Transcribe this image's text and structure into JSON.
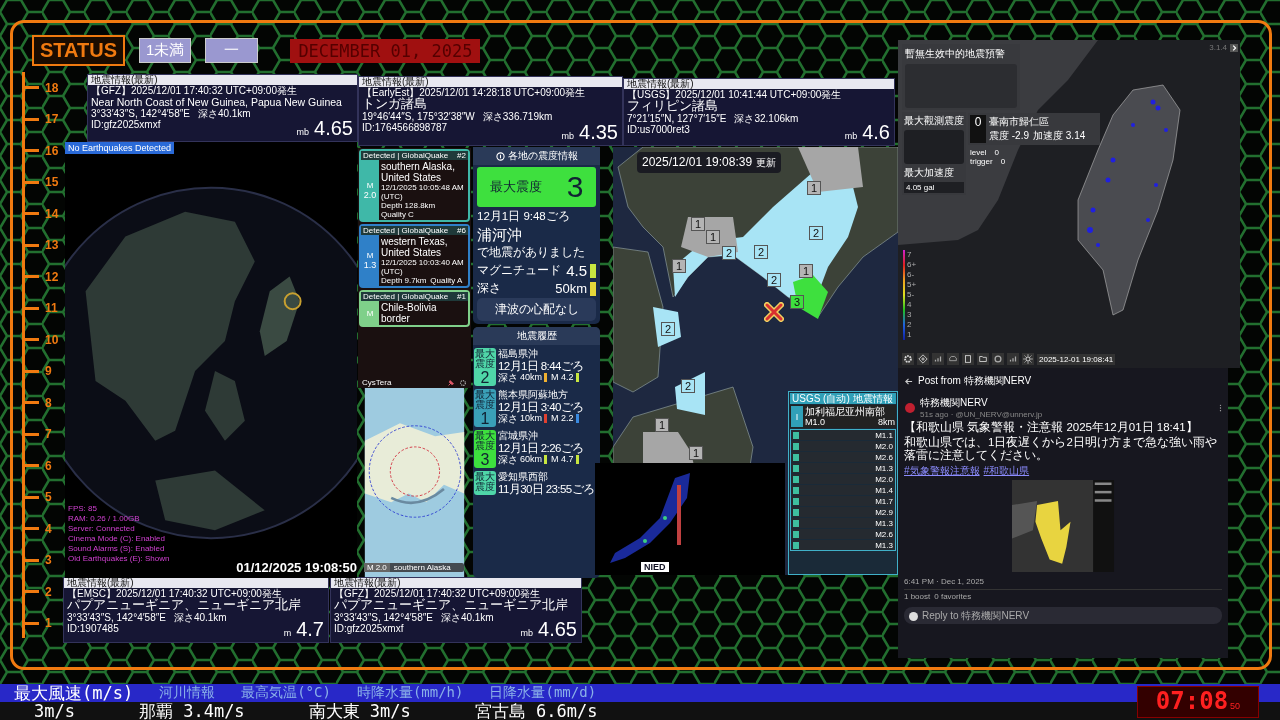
{
  "scale": [
    "18",
    "17",
    "16",
    "15",
    "14",
    "13",
    "12",
    "11",
    "10",
    "9",
    "8",
    "7",
    "6",
    "5",
    "4",
    "3",
    "2",
    "1"
  ],
  "status": {
    "label": "STATUS",
    "level": "1未満",
    "dash": "一",
    "date": "DECEMBER 01, 2025"
  },
  "quake_cards": [
    {
      "header": "地震情報(最新)",
      "source_time": "【GFZ】2025/12/01 17:40:32 UTC+09:00発生",
      "place": "Near North Coast of New Guinea, Papua New Guinea",
      "coords": "3°33′43″S, 142°4′58″E",
      "depth": "深さ40.1km",
      "id": "ID:gfz2025xmxf",
      "mag_type": "mb",
      "magnitude": "4.65"
    },
    {
      "header": "地震情報(最新)",
      "source_time": "【EarlyEst】2025/12/01 14:28:18 UTC+09:00発生",
      "place": "トンガ諸島",
      "coords": "19°46′44″S, 175°32′38″W",
      "depth": "深さ336.719km",
      "id": "ID:1764566898787",
      "mag_type": "mb",
      "magnitude": "4.35"
    },
    {
      "header": "地震情報(最新)",
      "source_time": "【USGS】2025/12/01 10:41:44 UTC+09:00発生",
      "place": "フィリピン諸島",
      "coords": "7°21′15″N, 127°7′15″E",
      "depth": "深さ32.106km",
      "id": "ID:us7000ret3",
      "mag_type": "mb",
      "magnitude": "4.6"
    },
    {
      "header": "地震情報(最新)",
      "source_time": "【EMSC】2025/12/01 17:40:32 UTC+09:00発生",
      "place": "パプアニューギニア、ニューギニア北岸",
      "coords": "3°33′43″S, 142°4′58″E",
      "depth": "深さ40.1km",
      "id": "ID:1907485",
      "mag_type": "m",
      "magnitude": "4.7"
    },
    {
      "header": "地震情報(最新)",
      "source_time": "【GFZ】2025/12/01 17:40:32 UTC+09:00発生",
      "place": "パプアニューギニア、ニューギニア北岸",
      "coords": "3°33′43″S, 142°4′58″E",
      "depth": "深さ40.1km",
      "id": "ID:gfz2025xmxf",
      "mag_type": "mb",
      "magnitude": "4.65"
    }
  ],
  "globe": {
    "banner": "No Earthquakes Detected",
    "stats": [
      "FPS: 85",
      "RAM: 0.26 / 1.00GB",
      "Server: Connected",
      "Cinema Mode (C): Enabled",
      "Sound Alarms (S): Enabled",
      "Old Earthquakes (E): Shown"
    ],
    "timestamp": "01/12/2025 19:08:50"
  },
  "globalquake": {
    "cards": [
      {
        "header": "Detected | GlobalQuake",
        "num": "#2",
        "mag_label": "M",
        "magnitude": "2.0",
        "place": "southern Alaska, United States",
        "time": "12/1/2025 10:05:48 AM (UTC)",
        "depth": "Depth 128.8km",
        "quality": "Quality C",
        "color": "#3fb8a8"
      },
      {
        "header": "Detected | GlobalQuake",
        "num": "#6",
        "mag_label": "M",
        "magnitude": "1.3",
        "place": "western Texas, United States",
        "time": "12/1/2025 10:03:40 AM (UTC)",
        "depth": "Depth 9.7km",
        "quality": "Quality A",
        "color": "#2f80c8"
      },
      {
        "header": "Detected | GlobalQuake",
        "num": "#1",
        "mag_label": "M",
        "place": "Chile-Bolivia border",
        "color": "#7fd08a"
      }
    ],
    "footer": "CysTera",
    "map_card": {
      "mag_label": "M",
      "magnitude": "2.0",
      "place": "southern Alaska"
    }
  },
  "intensity": {
    "title": "各地の震度情報",
    "max_label": "最大震度",
    "max_value": "3",
    "time": "12月1日 9:48ごろ",
    "epicenter": "浦河沖",
    "epicenter_suffix": "で地震がありました",
    "magnitude_label": "マグニチュード",
    "magnitude": "4.5",
    "depth_label": "深さ",
    "depth": "50km",
    "bars": [
      {
        "color": "#c8e640"
      },
      {
        "color": "#e6d83a"
      }
    ],
    "tsunami": "津波の心配なし",
    "history_title": "地震履歴",
    "history": [
      {
        "badge": "最大震度",
        "intensity": "2",
        "color": "#4fd6a8",
        "place": "福島県沖",
        "time": "12月1日 8:44ごろ",
        "depth_label": "深さ",
        "depth": "40km",
        "magnitude": "M 4.2",
        "bars": [
          {
            "color": "#f0b030"
          },
          {
            "color": "#c8e640"
          }
        ]
      },
      {
        "badge": "最大震度",
        "intensity": "1",
        "color": "#3aa0b8",
        "place": "熊本県阿蘇地方",
        "time": "12月1日 3:40ごろ",
        "depth_label": "深さ",
        "depth": "10km",
        "magnitude": "M 2.2",
        "bars": [
          {
            "color": "#e04030"
          },
          {
            "color": "#3a8ae0"
          }
        ]
      },
      {
        "badge": "最大震度",
        "intensity": "3",
        "color": "#3ee03e",
        "place": "宮城県沖",
        "time": "12月1日 2:26ごろ",
        "depth_label": "深さ",
        "depth": "60km",
        "magnitude": "M 4.7",
        "bars": [
          {
            "color": "#c8e640"
          },
          {
            "color": "#c8e640"
          }
        ]
      },
      {
        "badge": "最大震度",
        "color": "#4fd6a8",
        "place": "愛知県西部",
        "time": "11月30日 23:55ごろ"
      }
    ]
  },
  "hokkaido": {
    "timestamp": "2025/12/01 19:08:39",
    "updated": "更新",
    "markers": [
      {
        "kind": "i1",
        "label": "1"
      },
      {
        "kind": "i1",
        "label": "1"
      },
      {
        "kind": "i1",
        "label": "1"
      },
      {
        "kind": "i2",
        "label": "2"
      },
      {
        "kind": "i2",
        "label": "2"
      },
      {
        "kind": "i2",
        "label": "2"
      },
      {
        "kind": "i1",
        "label": "1"
      },
      {
        "kind": "i1",
        "label": "1"
      },
      {
        "kind": "i2",
        "label": "2"
      },
      {
        "kind": "i3",
        "label": "3"
      },
      {
        "kind": "i2",
        "label": "2"
      },
      {
        "kind": "i2",
        "label": "2"
      },
      {
        "kind": "i1",
        "label": "1"
      },
      {
        "kind": "i1",
        "label": "1"
      }
    ]
  },
  "usgs": {
    "title": "USGS (自动) 地震情報",
    "intensity": "I",
    "place": "加利福尼亚州南部",
    "magnitude": "M1.0",
    "depth": "8km",
    "list": [
      "M1.1",
      "M2.0",
      "M2.6",
      "M1.3",
      "M2.0",
      "M1.4",
      "M1.7",
      "M2.9",
      "M1.3",
      "M2.6",
      "M1.3"
    ]
  },
  "nied": {
    "logo": "NIED"
  },
  "taiwan": {
    "warning_title": "暫無生效中的地震預警",
    "max_intensity_label": "最大觀測震度",
    "station_intensity": "0",
    "station": "臺南市歸仁區",
    "station_reading": "震度 -2.9",
    "station_accel": "加速度 3.14",
    "level_label": "level",
    "level_value": "0",
    "trigger_label": "trigger",
    "trigger_value": "0",
    "max_accel_label": "最大加速度",
    "max_accel": "4.05 gal",
    "version": "3.1.4",
    "scale": [
      "7",
      "6+",
      "6-",
      "5+",
      "5-",
      "4",
      "3",
      "2",
      "1"
    ],
    "time": "2025-12-01 19:08:41"
  },
  "post": {
    "title": "Post from 特務機関NERV",
    "author": "特務機関NERV",
    "meta": "51s ago · @UN_NERV@unnerv.jp",
    "headline": "【和歌山県 気象警報・注意報 2025年12月01日 18:41】",
    "body": "和歌山県では、1日夜遅くから2日明け方まで急な強い雨や落雷に注意してください。",
    "tags": [
      "#気象警報注意報",
      "#和歌山県"
    ],
    "date": "6:41 PM · Dec 1, 2025",
    "boosts": "1 boost",
    "favorites": "0 favorites",
    "reply_placeholder": "Reply to 特務機関NERV"
  },
  "ticker": {
    "headings": [
      "最大風速(m/s)",
      "河川情報",
      "最高気温(°C)",
      "時降水量(mm/h)",
      "日降水量(mm/d)"
    ],
    "values": [
      "3m/s",
      "那覇 3.4m/s",
      "南大東 3m/s",
      "宮古島 6.6m/s"
    ]
  },
  "clock": {
    "time": "07:08",
    "seconds": "50"
  }
}
